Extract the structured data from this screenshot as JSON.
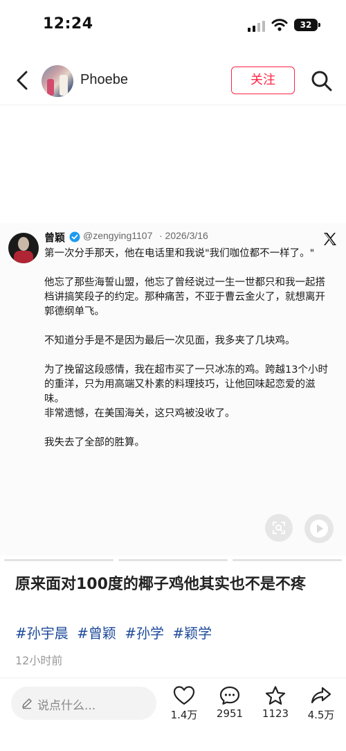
{
  "status_bar": {
    "time": "12:24",
    "battery": "32"
  },
  "header": {
    "user_name": "Phoebe",
    "follow_label": "关注"
  },
  "tweet": {
    "name": "曾颖",
    "handle": "@zengying1107",
    "date": "· 2026/3/16",
    "paragraphs": [
      "第一次分手那天，他在电话里和我说\"我们咖位都不一样了。\"",
      "",
      "他忘了那些海誓山盟，他忘了曾经说过一生一世都只和我一起搭档讲搞笑段子的约定。那种痛苦，不亚于曹云金火了，就想离开郭德纲单飞。",
      "",
      "不知道分手是不是因为最后一次见面，我多夹了几块鸡。",
      "",
      "为了挽留这段感情，我在超市买了一只冰冻的鸡。跨越13个小时的重洋，只为用高端又朴素的料理技巧，让他回味起恋爱的滋味。",
      "非常遗憾，在美国海关，这只鸡被没收了。",
      "",
      "我失去了全部的胜算。"
    ]
  },
  "post": {
    "title": "原来面对100度的椰子鸡他其实也不是不疼",
    "hashtags": [
      "#孙宇晨",
      "#曾颖",
      "#孙学",
      "#颖学"
    ],
    "timestamp": "12小时前"
  },
  "bottom_bar": {
    "comment_placeholder": "说点什么...",
    "likes": "1.4万",
    "comments": "2951",
    "favorites": "1123",
    "shares": "4.5万"
  },
  "icons": [
    "back-icon",
    "search-icon",
    "verified-icon",
    "x-logo",
    "scan-icon",
    "play-icon",
    "pencil-icon",
    "heart-icon",
    "comment-icon",
    "star-icon",
    "share-icon"
  ],
  "colors": {
    "accent": "#ff2442",
    "hashtag": "#1e4a9a",
    "verified": "#1d9bf0"
  }
}
